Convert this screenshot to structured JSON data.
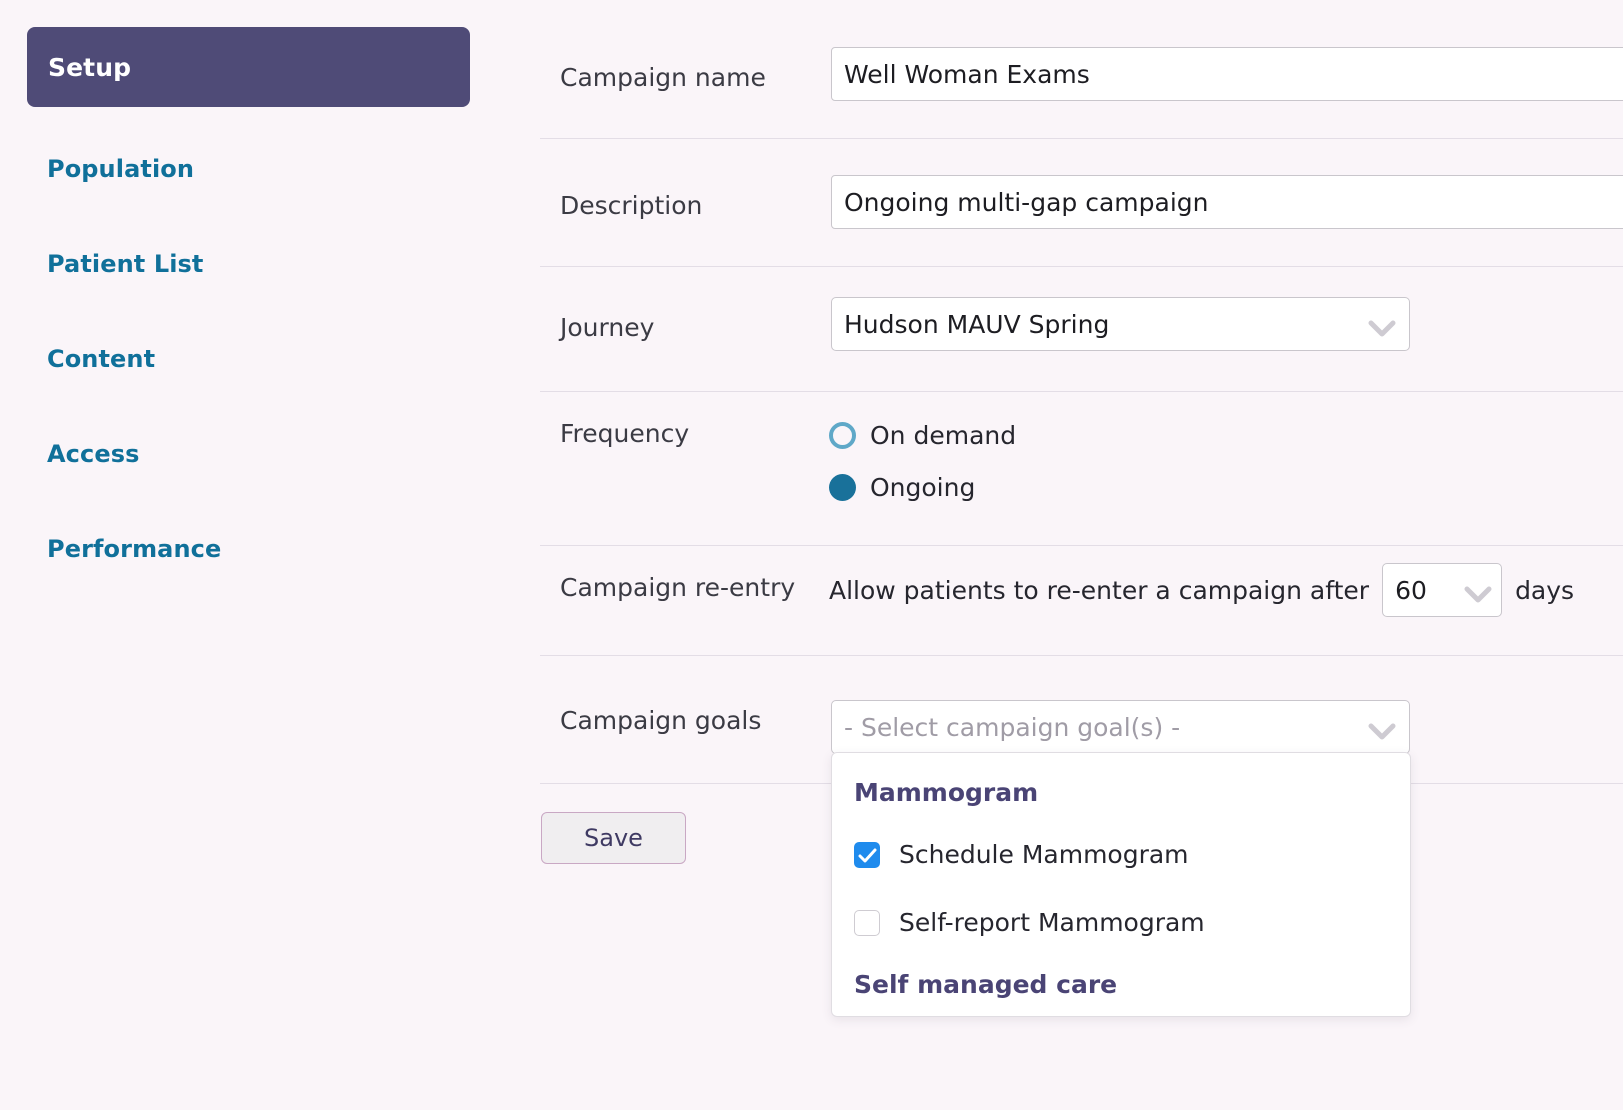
{
  "sidebar": {
    "items": [
      {
        "label": "Setup",
        "active": true
      },
      {
        "label": "Population",
        "active": false
      },
      {
        "label": "Patient List",
        "active": false
      },
      {
        "label": "Content",
        "active": false
      },
      {
        "label": "Access",
        "active": false
      },
      {
        "label": "Performance",
        "active": false
      }
    ]
  },
  "form": {
    "campaign_name": {
      "label": "Campaign name",
      "value": "Well Woman Exams",
      "placeholder": ""
    },
    "description": {
      "label": "Description",
      "value": "Ongoing multi-gap campaign",
      "placeholder": ""
    },
    "journey": {
      "label": "Journey",
      "value": "Hudson MAUV Spring",
      "chevron_icon": "chevron-down-icon"
    },
    "frequency": {
      "label": "Frequency",
      "options": [
        {
          "label": "On demand",
          "selected": false
        },
        {
          "label": "Ongoing",
          "selected": true
        }
      ]
    },
    "campaign_reentry": {
      "label": "Campaign re-entry",
      "prefix_text": "Allow patients to re-enter a campaign after",
      "days_value": "60",
      "suffix_text": "days",
      "chevron_icon": "chevron-down-icon"
    },
    "campaign_goals": {
      "label": "Campaign goals",
      "placeholder": "- Select campaign goal(s) -",
      "chevron_icon": "chevron-down-icon",
      "dropdown": {
        "groups": [
          {
            "header": "Mammogram",
            "options": [
              {
                "label": "Schedule Mammogram",
                "checked": true
              },
              {
                "label": "Self-report Mammogram",
                "checked": false
              }
            ]
          },
          {
            "header": "Self managed care",
            "options": []
          }
        ]
      }
    },
    "save_label": "Save"
  },
  "colors": {
    "background": "#faf5f9",
    "active_nav": "#4f4b77",
    "nav_link": "#10709a",
    "radio_selected": "#19719a",
    "radio_unselected_ring": "#5fa8c8",
    "checkbox_checked": "#1f8bed",
    "group_header": "#4a4475",
    "save_border": "#c9a8c4",
    "save_text": "#3f3a63"
  }
}
